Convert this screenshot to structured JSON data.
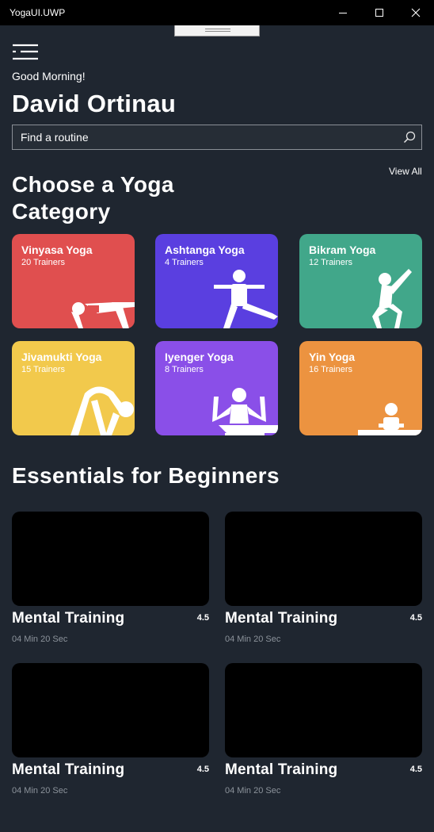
{
  "window": {
    "title": "YogaUI.UWP"
  },
  "header": {
    "greeting": "Good Morning!",
    "user_name": "David Ortinau"
  },
  "search": {
    "placeholder": "Find a routine"
  },
  "categories_section": {
    "title_line1": "Choose a Yoga",
    "title_line2": "Category",
    "view_all": "View All"
  },
  "categories": [
    {
      "name": "Vinyasa Yoga",
      "trainers": "20 Trainers",
      "color": "#e04f4f"
    },
    {
      "name": "Ashtanga Yoga",
      "trainers": "4 Trainers",
      "color": "#5a3fe0"
    },
    {
      "name": "Bikram Yoga",
      "trainers": "12 Trainers",
      "color": "#41a78a"
    },
    {
      "name": "Jivamukti Yoga",
      "trainers": "15 Trainers",
      "color": "#f2c94c"
    },
    {
      "name": "Iyenger Yoga",
      "trainers": "8 Trainers",
      "color": "#8a4fe8"
    },
    {
      "name": "Yin Yoga",
      "trainers": "16 Trainers",
      "color": "#ec9340"
    }
  ],
  "essentials_section": {
    "title": "Essentials for Beginners"
  },
  "videos": [
    {
      "title": "Mental Training",
      "rating": "4.5",
      "duration": "04 Min 20 Sec"
    },
    {
      "title": "Mental Training",
      "rating": "4.5",
      "duration": "04 Min 20 Sec"
    },
    {
      "title": "Mental Training",
      "rating": "4.5",
      "duration": "04 Min 20 Sec"
    },
    {
      "title": "Mental Training",
      "rating": "4.5",
      "duration": "04 Min 20 Sec"
    }
  ],
  "icons": [
    "minimize-icon",
    "maximize-icon",
    "close-icon",
    "hamburger-icon",
    "search-icon"
  ]
}
